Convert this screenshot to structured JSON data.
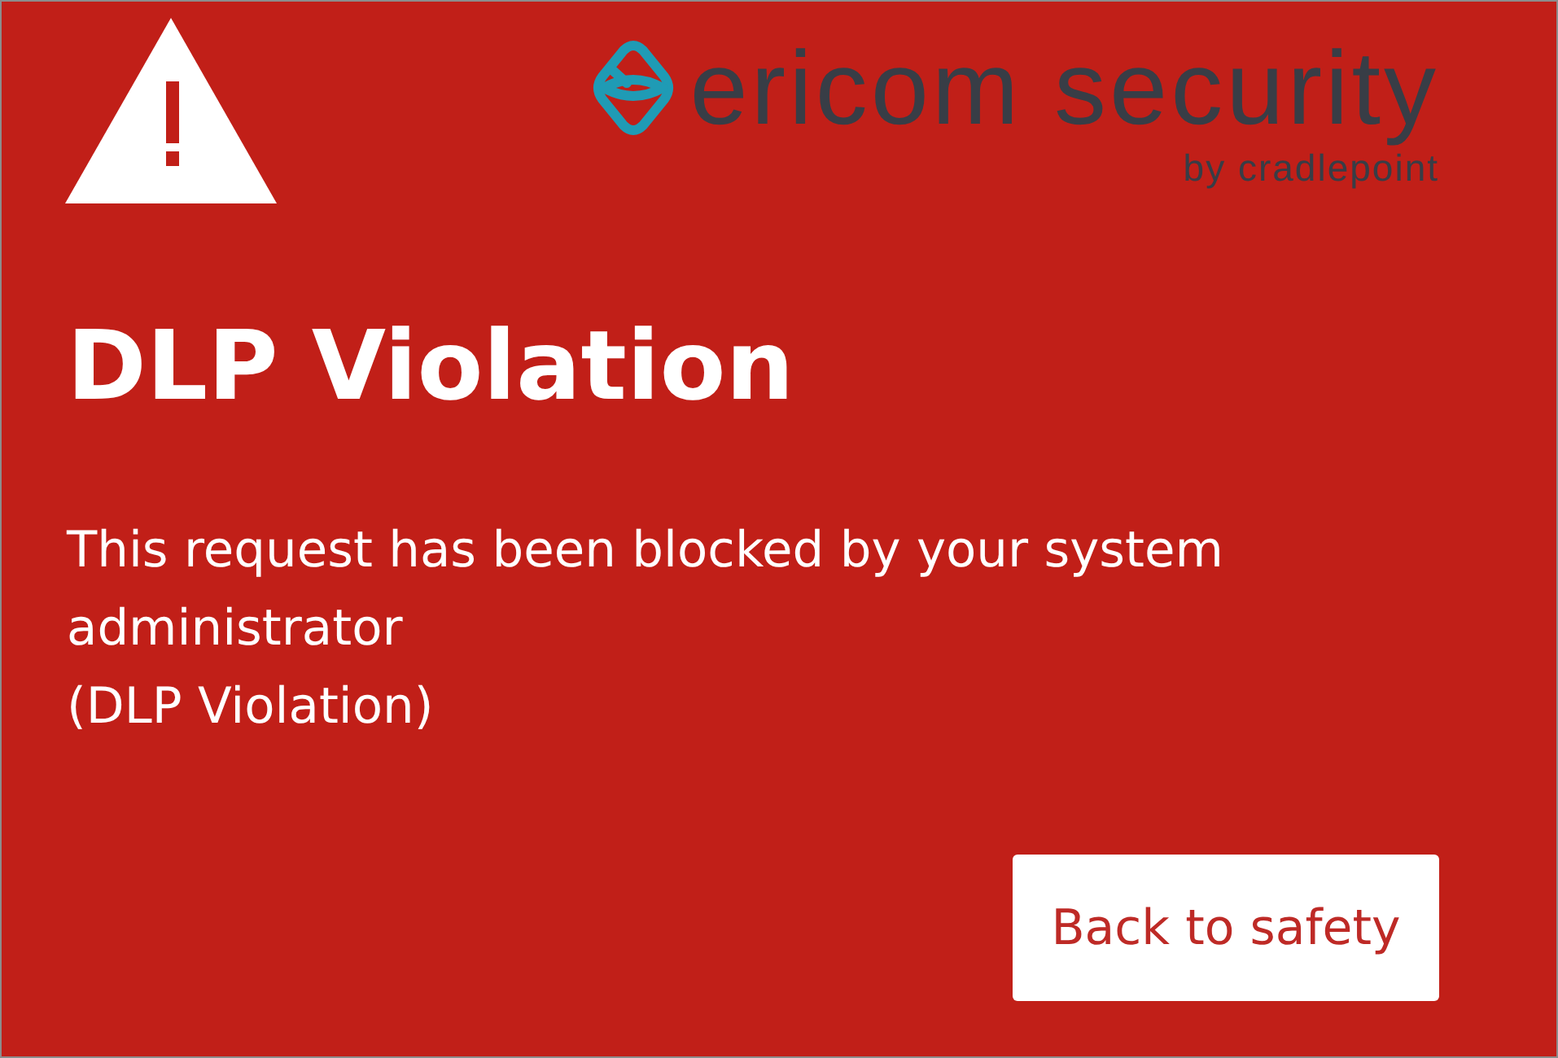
{
  "header": {
    "logo": {
      "name": "ericom security",
      "tagline": "by cradlepoint"
    }
  },
  "title": "DLP Violation",
  "message": [
    "This request has been blocked by your system administrator",
    "(DLP Violation)"
  ],
  "button": {
    "label": "Back to safety"
  }
}
